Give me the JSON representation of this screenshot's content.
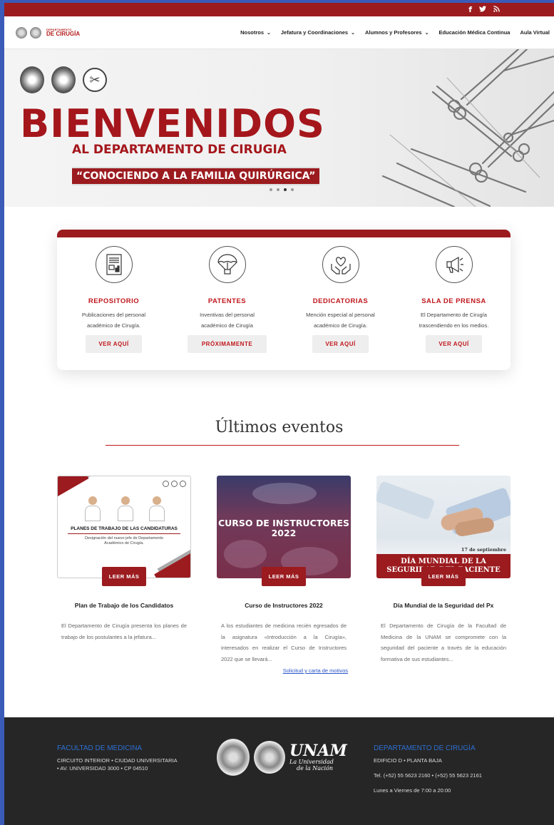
{
  "topbar": {
    "social": [
      {
        "name": "facebook-icon",
        "glyph": "f"
      },
      {
        "name": "twitter-icon",
        "glyph": "🐦"
      },
      {
        "name": "rss-icon",
        "glyph": "⧨"
      }
    ]
  },
  "header": {
    "logo_small": "DEPARTAMENTO",
    "logo_big": "DE CIRUGÍA",
    "nav": [
      {
        "label": "Nosotros",
        "dropdown": true
      },
      {
        "label": "Jefatura y Coordinaciones",
        "dropdown": true
      },
      {
        "label": "Alumnos y Profesores",
        "dropdown": true
      },
      {
        "label": "Educación Médica Continua",
        "dropdown": false
      },
      {
        "label": "Aula Virtual",
        "dropdown": false
      }
    ]
  },
  "hero": {
    "title": "BIENVENIDOS",
    "subtitle": "AL DEPARTAMENTO DE CIRUGIA",
    "tagline": "“CONOCIENDO A LA FAMILIA QUIRÚRGICA”",
    "slides": 4,
    "active_slide": 3
  },
  "services": [
    {
      "icon": "document-chart-icon",
      "title": "REPOSITORIO",
      "desc1": "Publicaciones del personal",
      "desc2": "académico de Cirugía.",
      "button": "VER AQUÍ"
    },
    {
      "icon": "parachute-icon",
      "title": "PATENTES",
      "desc1": "Inventivas del personal",
      "desc2": "académico de Cirugía",
      "button": "PRÓXIMAMENTE"
    },
    {
      "icon": "heart-hands-icon",
      "title": "DEDICATORIAS",
      "desc1": "Mención especial al personal",
      "desc2": "académico de Cirugía.",
      "button": "VER AQUÍ"
    },
    {
      "icon": "megaphone-icon",
      "title": "SALA DE PRENSA",
      "desc1": "El Departamento de Cirugía",
      "desc2": "trascendiendo en los medios.",
      "button": "VER AQUÍ"
    }
  ],
  "events_section": {
    "title": "Últimos eventos"
  },
  "events": [
    {
      "image_caption": "PLANES DE TRABAJO DE LAS CANDIDATURAS",
      "image_sub": "Designación del nuevo jefe de Departamento Académico de Cirugía.",
      "button": "LEER MÁS",
      "title": "Plan de Trabajo de los Candidatos",
      "text": "El Departamento de Cirugía presenta los planes de trabajo de los postulantes a la jefatura...",
      "link": ""
    },
    {
      "image_caption": "CURSO DE INSTRUCTORES 2022",
      "button": "LEER MÁS",
      "title": "Curso de Instructores 2022",
      "text": "A los estudiantes de medicina recién egresados de la asignatura «Introducción a la Cirugía», interesados en realizar el Curso de Instructores 2022 que se llevará...",
      "link": "Solicitud y carta de motivos"
    },
    {
      "image_date": "17 de septiembre",
      "image_banner": "DÍA MUNDIAL DE LA SEGURIDAD DEL PACIENTE",
      "button": "LEER MÁS",
      "title": "Día Mundial de la Seguridad del Px",
      "text": "El Departamento de Cirugía de la Facultad de Medicina de la UNAM se compromete con la seguridad del paciente a través de la educación formativa de sus estudiantes...",
      "link": ""
    }
  ],
  "footer": {
    "left": {
      "heading": "FACULTAD DE MEDICINA",
      "line1": "CIRCUITO INTERIOR • CIUDAD UNIVERSITARIA",
      "line2": "• AV. UNIVERSIDAD 3000 • CP 04510"
    },
    "unam": {
      "mark": "UNAM",
      "slogan1": "La Universidad",
      "slogan2": "de la Nación"
    },
    "right": {
      "heading": "DEPARTAMENTO DE CIRUGÍA",
      "line1": "EDIFICIO D • PLANTA BAJA",
      "line2": "Tel. (+52) 55 5623 2160 • (+52) 55 5623 2161",
      "line3": "Lunes a Viernes de 7:00 a 20:00"
    }
  }
}
